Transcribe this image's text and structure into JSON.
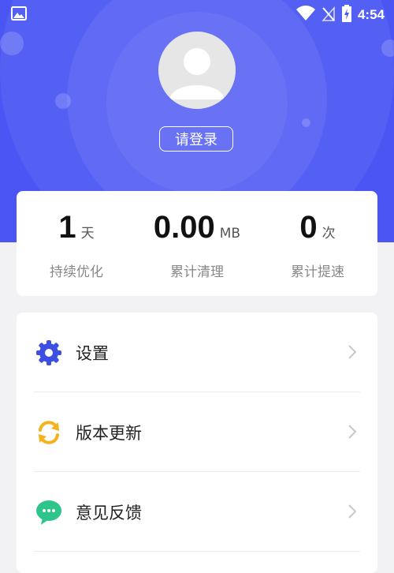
{
  "status_bar": {
    "time": "4:54",
    "icons": [
      "image-icon",
      "wifi-icon",
      "no-signal-icon",
      "battery-charging-icon"
    ]
  },
  "header": {
    "login_label": "请登录",
    "avatar_icon": "user-avatar-icon",
    "background_color": "#4a55f4"
  },
  "stats": [
    {
      "value": "1",
      "unit": "天",
      "label": "持续优化"
    },
    {
      "value": "0.00",
      "unit": "MB",
      "label": "累计清理"
    },
    {
      "value": "0",
      "unit": "次",
      "label": "累计提速"
    }
  ],
  "menu": {
    "items": [
      {
        "label": "设置",
        "icon": "gear-icon",
        "icon_color": "#3d4fe0"
      },
      {
        "label": "版本更新",
        "icon": "refresh-icon",
        "icon_color": "#f5b21b"
      },
      {
        "label": "意见反馈",
        "icon": "chat-icon",
        "icon_color": "#2ec48a"
      }
    ]
  }
}
